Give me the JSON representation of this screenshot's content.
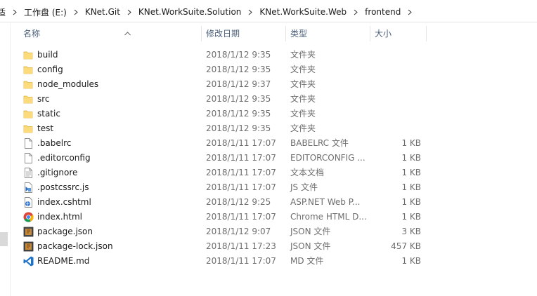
{
  "breadcrumb": {
    "partial": "适",
    "items": [
      "工作盘 (E:)",
      "KNet.Git",
      "KNet.WorkSuite.Solution",
      "KNet.WorkSuite.Web",
      "frontend"
    ]
  },
  "columns": {
    "name": "名称",
    "date": "修改日期",
    "type": "类型",
    "size": "大小"
  },
  "files": [
    {
      "icon": "folder-icon",
      "name": "build",
      "date": "2018/1/12 9:35",
      "type": "文件夹",
      "size": ""
    },
    {
      "icon": "folder-icon",
      "name": "config",
      "date": "2018/1/12 9:35",
      "type": "文件夹",
      "size": ""
    },
    {
      "icon": "folder-icon",
      "name": "node_modules",
      "date": "2018/1/12 9:37",
      "type": "文件夹",
      "size": ""
    },
    {
      "icon": "folder-icon",
      "name": "src",
      "date": "2018/1/12 9:35",
      "type": "文件夹",
      "size": ""
    },
    {
      "icon": "folder-icon",
      "name": "static",
      "date": "2018/1/12 9:35",
      "type": "文件夹",
      "size": ""
    },
    {
      "icon": "folder-icon",
      "name": "test",
      "date": "2018/1/12 9:35",
      "type": "文件夹",
      "size": ""
    },
    {
      "icon": "blank-file-icon",
      "name": ".babelrc",
      "date": "2018/1/11 17:07",
      "type": "BABELRC 文件",
      "size": "1 KB"
    },
    {
      "icon": "blank-file-icon",
      "name": ".editorconfig",
      "date": "2018/1/11 17:07",
      "type": "EDITORCONFIG ...",
      "size": "1 KB"
    },
    {
      "icon": "text-file-icon",
      "name": ".gitignore",
      "date": "2018/1/11 17:07",
      "type": "文本文档",
      "size": "1 KB"
    },
    {
      "icon": "js-file-icon",
      "name": ".postcssrc.js",
      "date": "2018/1/11 17:07",
      "type": "JS 文件",
      "size": "1 KB"
    },
    {
      "icon": "aspnet-file-icon",
      "name": "index.cshtml",
      "date": "2018/1/12 9:25",
      "type": "ASP.NET Web P...",
      "size": "1 KB"
    },
    {
      "icon": "chrome-icon",
      "name": "index.html",
      "date": "2018/1/11 17:07",
      "type": "Chrome HTML D...",
      "size": "1 KB"
    },
    {
      "icon": "json-file-icon",
      "name": "package.json",
      "date": "2018/1/12 9:07",
      "type": "JSON 文件",
      "size": "3 KB"
    },
    {
      "icon": "json-file-icon",
      "name": "package-lock.json",
      "date": "2018/1/11 17:23",
      "type": "JSON 文件",
      "size": "457 KB"
    },
    {
      "icon": "vscode-icon",
      "name": "README.md",
      "date": "2018/1/11 17:07",
      "type": "MD 文件",
      "size": "1 KB"
    }
  ]
}
